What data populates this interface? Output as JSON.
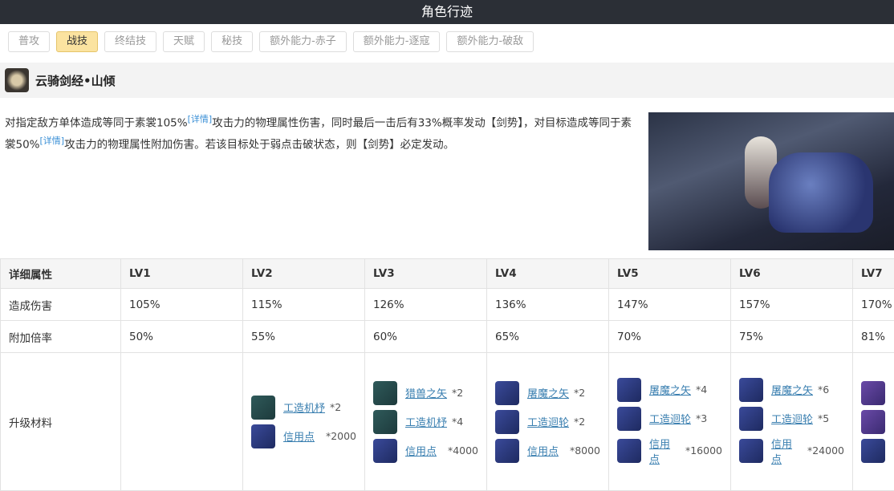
{
  "title": "角色行迹",
  "tabs": [
    {
      "label": "普攻"
    },
    {
      "label": "战技",
      "active": true
    },
    {
      "label": "终结技"
    },
    {
      "label": "天赋"
    },
    {
      "label": "秘技"
    },
    {
      "label": "额外能力-赤子"
    },
    {
      "label": "额外能力-逐寇"
    },
    {
      "label": "额外能力-破敌"
    }
  ],
  "skill": {
    "name": "云骑剑经•山倾",
    "desc1a": "对指定敌方单体造成等同于素裳105%",
    "detail": "[详情]",
    "desc1b": "攻击力的物理属性伤害，同时最后一击后有33%概率发动【剑势】，对目标造成等同于素裳50%",
    "desc1c": "攻击力的物理属性附加伤害。若该目标处于弱点击破状态，则【剑势】必定发动。"
  },
  "table": {
    "headers": [
      "详细属性",
      "LV1",
      "LV2",
      "LV3",
      "LV4",
      "LV5",
      "LV6",
      "LV7"
    ],
    "rows": [
      [
        "造成伤害",
        "105%",
        "115%",
        "126%",
        "136%",
        "147%",
        "157%",
        "170%"
      ],
      [
        "附加倍率",
        "50%",
        "55%",
        "60%",
        "65%",
        "70%",
        "75%",
        "81%"
      ]
    ],
    "materials_label": "升级材料",
    "materials": [
      [],
      [
        {
          "name": "工造机杼",
          "count": "*2",
          "icon": "m-teal"
        },
        {
          "name": "信用点",
          "count": "*2000",
          "icon": "m-blue"
        }
      ],
      [
        {
          "name": "猎兽之矢",
          "count": "*2",
          "icon": "m-teal"
        },
        {
          "name": "工造机杼",
          "count": "*4",
          "icon": "m-teal"
        },
        {
          "name": "信用点",
          "count": "*4000",
          "icon": "m-blue"
        }
      ],
      [
        {
          "name": "屠魔之矢",
          "count": "*2",
          "icon": "m-blue"
        },
        {
          "name": "工造迴轮",
          "count": "*2",
          "icon": "m-blue"
        },
        {
          "name": "信用点",
          "count": "*8000",
          "icon": "m-blue"
        }
      ],
      [
        {
          "name": "屠魔之矢",
          "count": "*4",
          "icon": "m-blue"
        },
        {
          "name": "工造迴轮",
          "count": "*3",
          "icon": "m-blue"
        },
        {
          "name": "信用点",
          "count": "*16000",
          "icon": "m-blue"
        }
      ],
      [
        {
          "name": "屠魔之矢",
          "count": "*6",
          "icon": "m-blue"
        },
        {
          "name": "工造迴轮",
          "count": "*5",
          "icon": "m-blue"
        },
        {
          "name": "信用点",
          "count": "*24000",
          "icon": "m-blue"
        }
      ],
      [
        {
          "name": "",
          "count": "",
          "icon": "m-purple"
        },
        {
          "name": "",
          "count": "",
          "icon": "m-purple"
        },
        {
          "name": "",
          "count": "",
          "icon": "m-blue"
        }
      ]
    ]
  }
}
